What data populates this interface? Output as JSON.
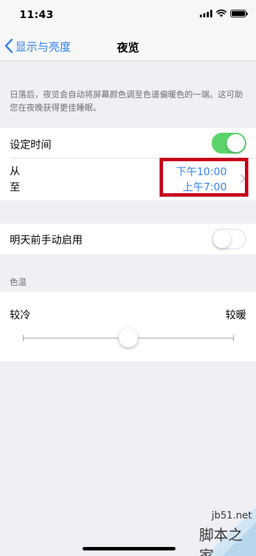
{
  "status_bar": {
    "time": "11:43"
  },
  "nav": {
    "back_label": "显示与亮度",
    "title": "夜览"
  },
  "description": "日落后，夜览会自动将屏幕颜色调至色谱偏暖色的一端。这可助您在夜晚获得更佳睡眠。",
  "schedule": {
    "label": "设定时间",
    "enabled": true,
    "from_label": "从",
    "to_label": "至",
    "from_time": "下午10:00",
    "to_time": "上午7:00"
  },
  "manual": {
    "label": "明天前手动启用",
    "enabled": false
  },
  "color_temperature": {
    "header": "色温",
    "cooler_label": "较冷",
    "warmer_label": "较暖",
    "level": 0.5
  },
  "watermark": {
    "site": "jb51.net",
    "brand": "脚本之家"
  },
  "colors": {
    "accent": "#2f7ef0",
    "toggle_on": "#5bd56b",
    "highlight": "#c6001a",
    "background": "#efeff4"
  },
  "icons": [
    "signal-icon",
    "wifi-icon",
    "battery-icon",
    "back-chevron-icon",
    "chevron-right-icon"
  ]
}
